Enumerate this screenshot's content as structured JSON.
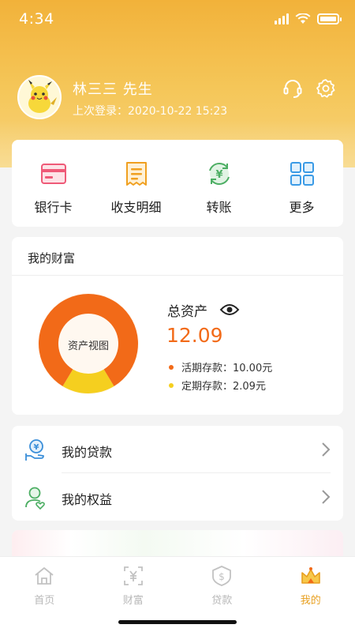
{
  "status_bar": {
    "time": "4:34"
  },
  "profile": {
    "name": "林三三   先生",
    "last_login": "上次登录：2020-10-22 15:23"
  },
  "quick_actions": [
    {
      "label": "银行卡",
      "icon": "bank-card-icon"
    },
    {
      "label": "收支明细",
      "icon": "receipt-icon"
    },
    {
      "label": "转账",
      "icon": "transfer-icon"
    },
    {
      "label": "更多",
      "icon": "grid-icon"
    }
  ],
  "wealth": {
    "title": "我的财富",
    "donut_label": "资产视图",
    "total_label": "总资产",
    "total_value": "12.09",
    "items": [
      {
        "label": "活期存款：10.00元",
        "color": "#f26a18",
        "value": 10.0
      },
      {
        "label": "定期存款：2.09元",
        "color": "#f5cf1f",
        "value": 2.09
      }
    ]
  },
  "menu": [
    {
      "label": "我的贷款",
      "icon": "loan-icon"
    },
    {
      "label": "我的权益",
      "icon": "rights-icon"
    }
  ],
  "tabbar": [
    {
      "label": "首页",
      "icon": "home-icon"
    },
    {
      "label": "财富",
      "icon": "wealth-icon"
    },
    {
      "label": "贷款",
      "icon": "loan-tab-icon"
    },
    {
      "label": "我的",
      "icon": "crown-icon"
    }
  ],
  "colors": {
    "header": "#f2b23a",
    "accent": "#f26a18",
    "tab_active": "#e8a020"
  }
}
